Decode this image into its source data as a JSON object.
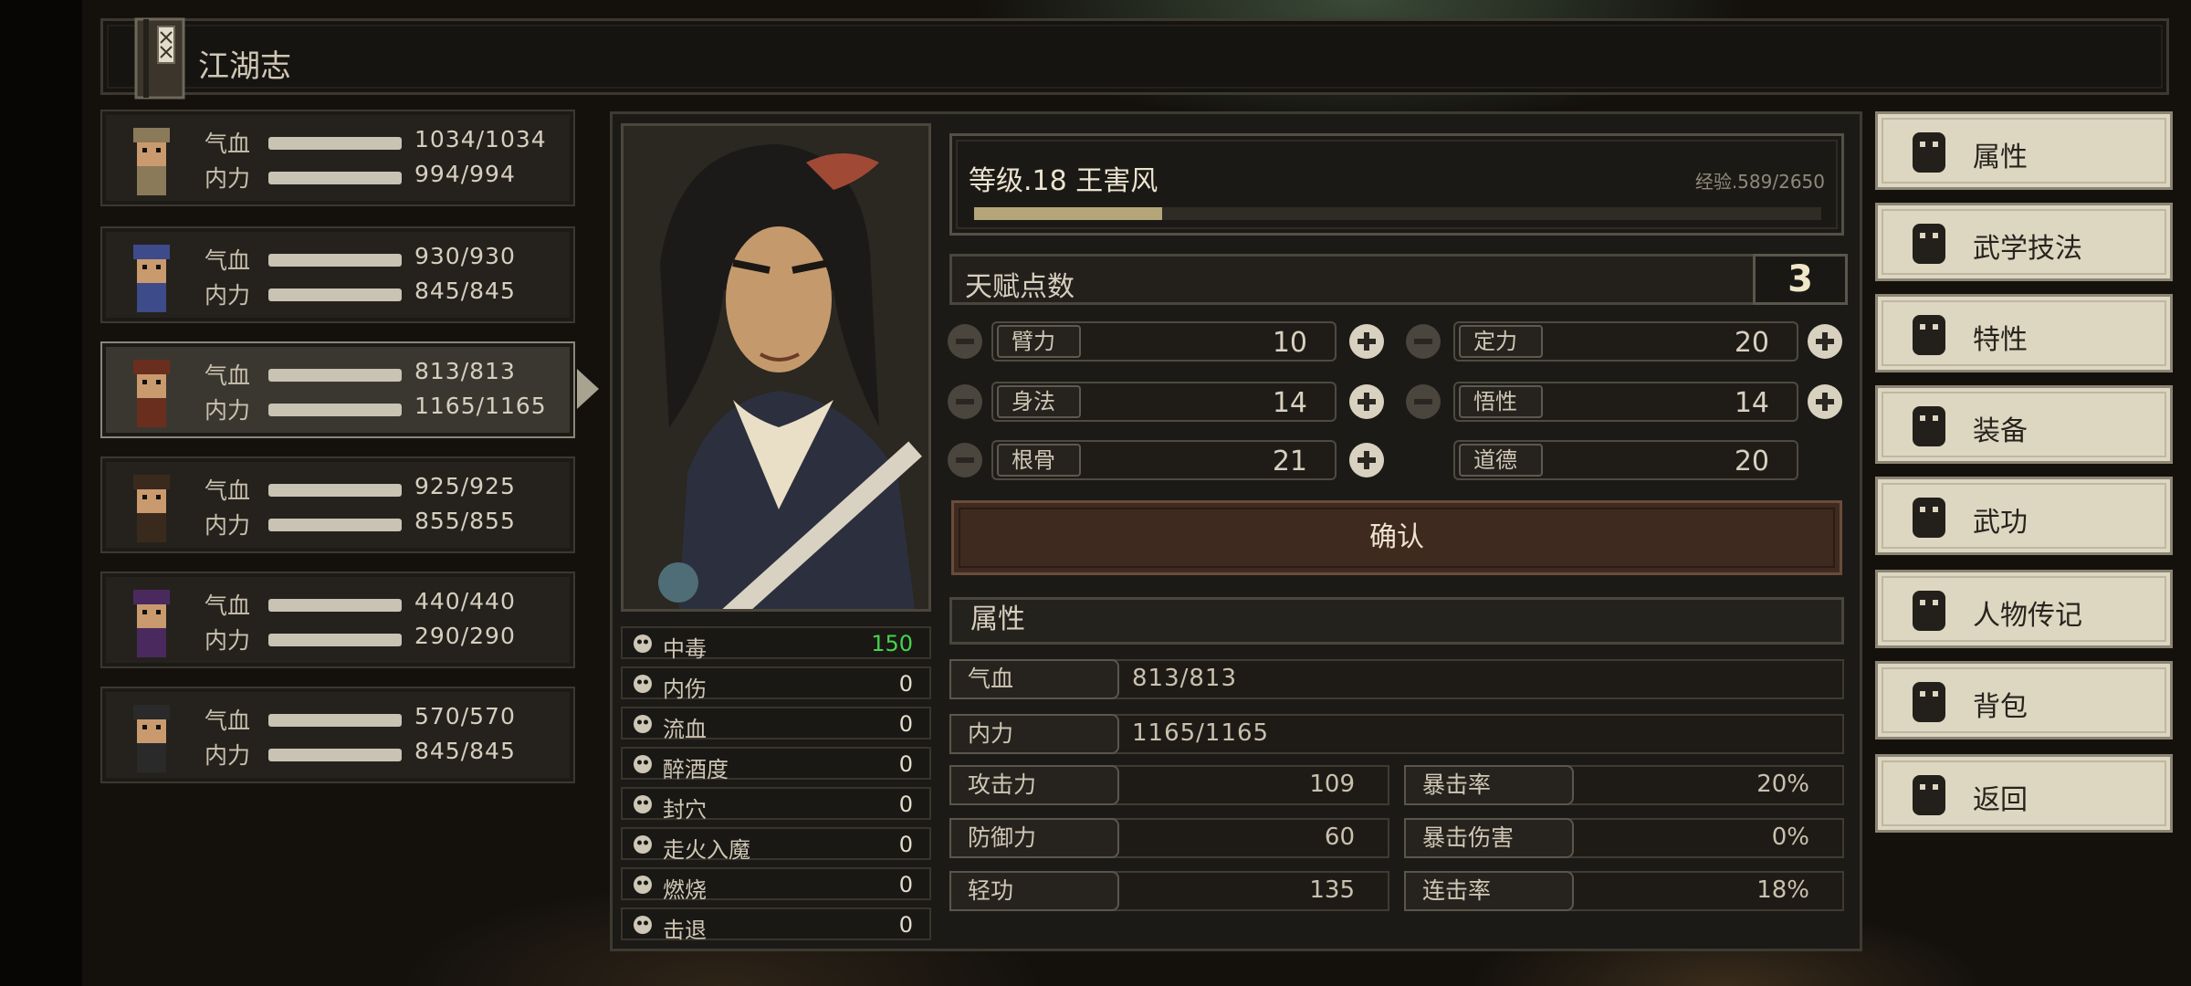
{
  "header": {
    "title": "江湖志"
  },
  "roster": [
    {
      "hp_label": "气血",
      "hp": "1034/1034",
      "hp_pct": 1.0,
      "mp_label": "内力",
      "mp": "994/994",
      "mp_pct": 1.0,
      "active": false
    },
    {
      "hp_label": "气血",
      "hp": "930/930",
      "hp_pct": 1.0,
      "mp_label": "内力",
      "mp": "845/845",
      "mp_pct": 1.0,
      "active": false
    },
    {
      "hp_label": "气血",
      "hp": "813/813",
      "hp_pct": 1.0,
      "mp_label": "内力",
      "mp": "1165/1165",
      "mp_pct": 1.0,
      "active": true
    },
    {
      "hp_label": "气血",
      "hp": "925/925",
      "hp_pct": 1.0,
      "mp_label": "内力",
      "mp": "855/855",
      "mp_pct": 1.0,
      "active": false
    },
    {
      "hp_label": "气血",
      "hp": "440/440",
      "hp_pct": 1.0,
      "mp_label": "内力",
      "mp": "290/290",
      "mp_pct": 1.0,
      "active": false
    },
    {
      "hp_label": "气血",
      "hp": "570/570",
      "hp_pct": 1.0,
      "mp_label": "内力",
      "mp": "845/845",
      "mp_pct": 1.0,
      "active": false
    }
  ],
  "status": [
    {
      "label": "中毒",
      "value": "150",
      "icon": "skull-icon"
    },
    {
      "label": "内伤",
      "value": "0",
      "icon": "broken-heart-icon"
    },
    {
      "label": "流血",
      "value": "0",
      "icon": "blood-splatter-icon"
    },
    {
      "label": "醉酒度",
      "value": "0",
      "icon": "drunk-face-icon"
    },
    {
      "label": "封穴",
      "value": "0",
      "icon": "acupoint-icon"
    },
    {
      "label": "走火入魔",
      "value": "0",
      "icon": "demon-face-icon"
    },
    {
      "label": "燃烧",
      "value": "0",
      "icon": "flame-icon"
    },
    {
      "label": "击退",
      "value": "0",
      "icon": "boot-icon"
    }
  ],
  "character": {
    "level_name": "等级.18  王害风",
    "exp_text": "经验.589/2650",
    "exp_pct": 0.222
  },
  "talent": {
    "label": "天赋点数",
    "points": "3"
  },
  "attributes": [
    {
      "label": "臂力",
      "value": "10",
      "editable": true
    },
    {
      "label": "定力",
      "value": "20",
      "editable": true
    },
    {
      "label": "身法",
      "value": "14",
      "editable": true
    },
    {
      "label": "悟性",
      "value": "14",
      "editable": true
    },
    {
      "label": "根骨",
      "value": "21",
      "editable": true
    },
    {
      "label": "道德",
      "value": "20",
      "editable": false
    }
  ],
  "confirm_label": "确认",
  "properties": {
    "title": "属性",
    "hp": {
      "label": "气血",
      "value": "813/813"
    },
    "mp": {
      "label": "内力",
      "value": "1165/1165"
    },
    "attack": {
      "label": "攻击力",
      "value": "109"
    },
    "crit": {
      "label": "暴击率",
      "value": "20%"
    },
    "defense": {
      "label": "防御力",
      "value": "60"
    },
    "crit_dmg": {
      "label": "暴击伤害",
      "value": "0%"
    },
    "qinggong": {
      "label": "轻功",
      "value": "135"
    },
    "combo": {
      "label": "连击率",
      "value": "18%"
    }
  },
  "menu": [
    {
      "label": "属性",
      "icon": "person-attributes-icon"
    },
    {
      "label": "武学技法",
      "icon": "person-skills-icon"
    },
    {
      "label": "特性",
      "icon": "person-traits-icon"
    },
    {
      "label": "装备",
      "icon": "sword-icon"
    },
    {
      "label": "武功",
      "icon": "manual-book-icon"
    },
    {
      "label": "人物传记",
      "icon": "scroll-icon"
    },
    {
      "label": "背包",
      "icon": "bag-icon"
    },
    {
      "label": "返回",
      "icon": "door-icon"
    }
  ],
  "colors": {
    "poison_value": "#46d34a",
    "exp_fill": "#b5a679",
    "confirm_bg": "#3f2a20",
    "menu_bg": "#ddd6c1"
  }
}
